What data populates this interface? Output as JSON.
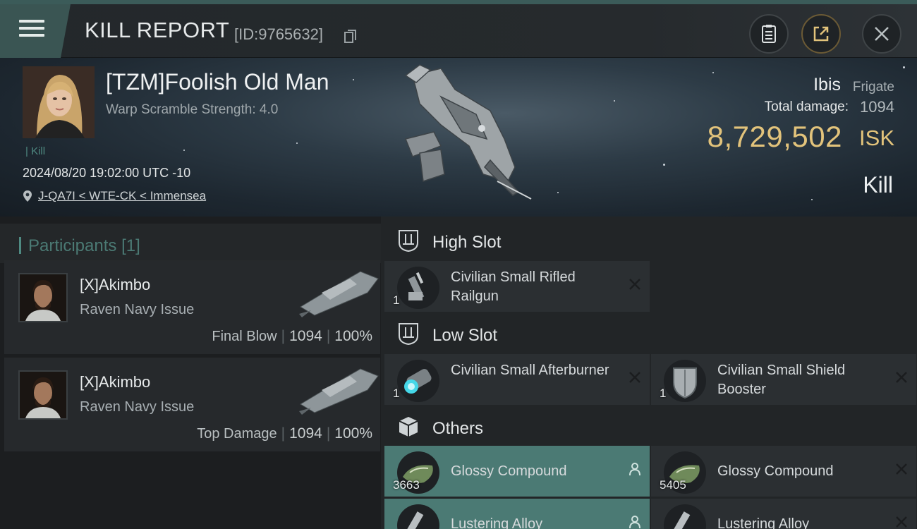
{
  "header": {
    "title": "KILL REPORT",
    "id_text": "[ID:9765632]"
  },
  "victim": {
    "name": "[TZM]Foolish Old Man",
    "warp_scramble": "Warp Scramble Strength: 4.0",
    "kill_tag": "Kill",
    "time": "2024/08/20 19:02:00 UTC -10",
    "location": "J-QA7I < WTE-CK < Immensea"
  },
  "ship": {
    "name": "Ibis",
    "class": "Frigate",
    "total_damage_label": "Total damage:",
    "total_damage": "1094",
    "isk_value": "8,729,502",
    "isk_unit": "ISK",
    "result": "Kill"
  },
  "participants": {
    "title": "Participants",
    "count": "[1]",
    "rows": [
      {
        "name": "[X]Akimbo",
        "ship": "Raven Navy Issue",
        "label": "Final Blow",
        "damage": "1094",
        "percent": "100%"
      },
      {
        "name": "[X]Akimbo",
        "ship": "Raven Navy Issue",
        "label": "Top Damage",
        "damage": "1094",
        "percent": "100%"
      }
    ]
  },
  "fitting": {
    "high_slot": {
      "title": "High Slot",
      "items": [
        {
          "name": "Civilian Small Rifled Railgun",
          "qty": "1"
        }
      ]
    },
    "low_slot": {
      "title": "Low Slot",
      "items": [
        {
          "name": "Civilian Small Afterburner",
          "qty": "1"
        },
        {
          "name": "Civilian Small Shield Booster",
          "qty": "1"
        }
      ]
    },
    "others": {
      "title": "Others",
      "items": [
        {
          "name": "Glossy Compound",
          "qty": "3663"
        },
        {
          "name": "Glossy Compound",
          "qty": "5405"
        },
        {
          "name": "Lustering Alloy",
          "qty": ""
        },
        {
          "name": "Lustering Alloy",
          "qty": ""
        }
      ]
    }
  },
  "colors": {
    "accent_teal": "#4b7a74",
    "isk_gold": "#e2c37b",
    "header_bar": "#3a5553"
  },
  "icons": [
    "menu-icon",
    "copy-icon",
    "clipboard-icon",
    "share-icon",
    "close-icon",
    "location-pin-icon",
    "high-slot-icon",
    "low-slot-icon",
    "others-box-icon",
    "remove-x-icon",
    "person-icon"
  ]
}
